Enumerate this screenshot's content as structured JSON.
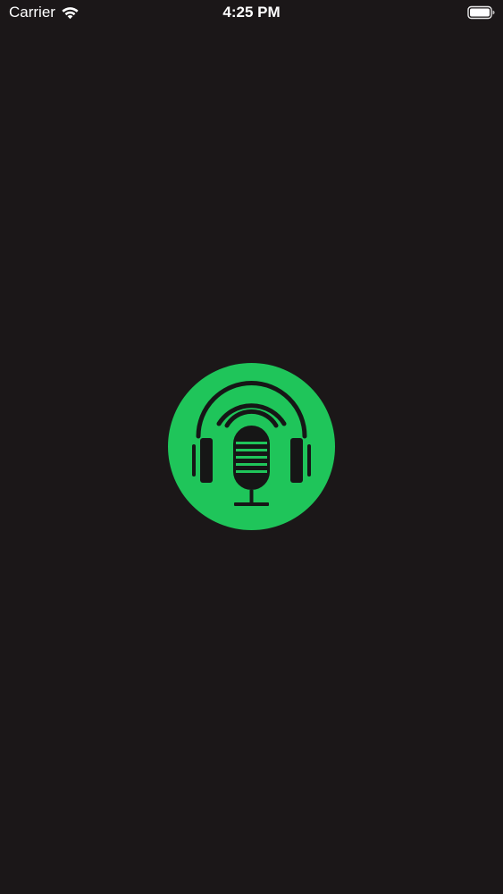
{
  "status_bar": {
    "carrier": "Carrier",
    "time": "4:25 PM",
    "wifi_icon": "wifi-icon",
    "battery_icon": "battery-icon"
  },
  "splash": {
    "logo_icon": "podcast-headphones-microphone-icon",
    "background_color": "#1b1718",
    "logo_color": "#1fc55a",
    "icon_color": "#161616"
  }
}
